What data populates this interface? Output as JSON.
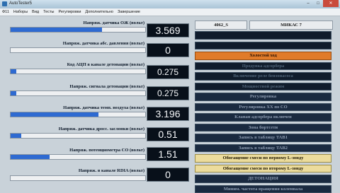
{
  "window": {
    "title": "AutoTester5"
  },
  "menu": [
    "Ф11",
    "Наборы",
    "Вид",
    "Тесты",
    "Регулировки",
    "Дополнительно",
    "Завершение"
  ],
  "rows": [
    {
      "label": "Напряж. датчика ОЖ (вольт)",
      "value": "3.569",
      "fill": 0.68
    },
    {
      "label": "Напряж. датчика абс. давления (вольт)",
      "value": "0",
      "fill": 0.0
    },
    {
      "label": "Код АЦП в канале детонации (вольт)",
      "value": "0.275",
      "fill": 0.04
    },
    {
      "label": "Напряж. сигнала детонации (вольт)",
      "value": "0.275",
      "fill": 0.04
    },
    {
      "label": "Напряж. датчика темп. воздуха (вольт)",
      "value": "3.196",
      "fill": 0.65
    },
    {
      "label": "Напряж. датчика дросс. заслонки (вольт)",
      "value": "0.51",
      "fill": 0.08
    },
    {
      "label": "Напряж. потенциометра СО (вольт)",
      "value": "1.51",
      "fill": 0.29
    },
    {
      "label": "Напряж. в канале RDIA (вольт)",
      "value": "0",
      "fill": 0.0
    }
  ],
  "ecu": {
    "left": "4062_S",
    "right": "МИКАС 7"
  },
  "status": [
    {
      "text": "",
      "state": "off"
    },
    {
      "text": "",
      "state": "off"
    },
    {
      "text": "Холостой ход",
      "state": "orange"
    },
    {
      "text": "Продувка адсорбера",
      "state": "off"
    },
    {
      "text": "Включение реле бензонасоса",
      "state": "off"
    },
    {
      "text": "Мощностной режим",
      "state": "off"
    },
    {
      "text": "Регулировка",
      "state": "mid"
    },
    {
      "text": "Регулировка ХХ по CO",
      "state": "mid"
    },
    {
      "text": "Клапан адсорбера включен",
      "state": "mid"
    },
    {
      "text": "Зона бортсети",
      "state": "mid"
    },
    {
      "text": "Запись в таблицу TAB1",
      "state": "mid"
    },
    {
      "text": "Запись в таблицу TAB2",
      "state": "mid"
    },
    {
      "text": "Обогащение смеси по первому L-зонду",
      "state": "yellow"
    },
    {
      "text": "Обогащение смеси по второму L-зонду",
      "state": "yellow"
    },
    {
      "text": "ДЕТОНАЦИЯ",
      "state": "mid"
    },
    {
      "text": "Миним. частота вращения коленвала",
      "state": "mid"
    }
  ],
  "colors": {
    "bar": "#2e6ad1",
    "orange": "#e07b2a",
    "yellow": "#ecdc9c",
    "panel": "#101c2c"
  }
}
